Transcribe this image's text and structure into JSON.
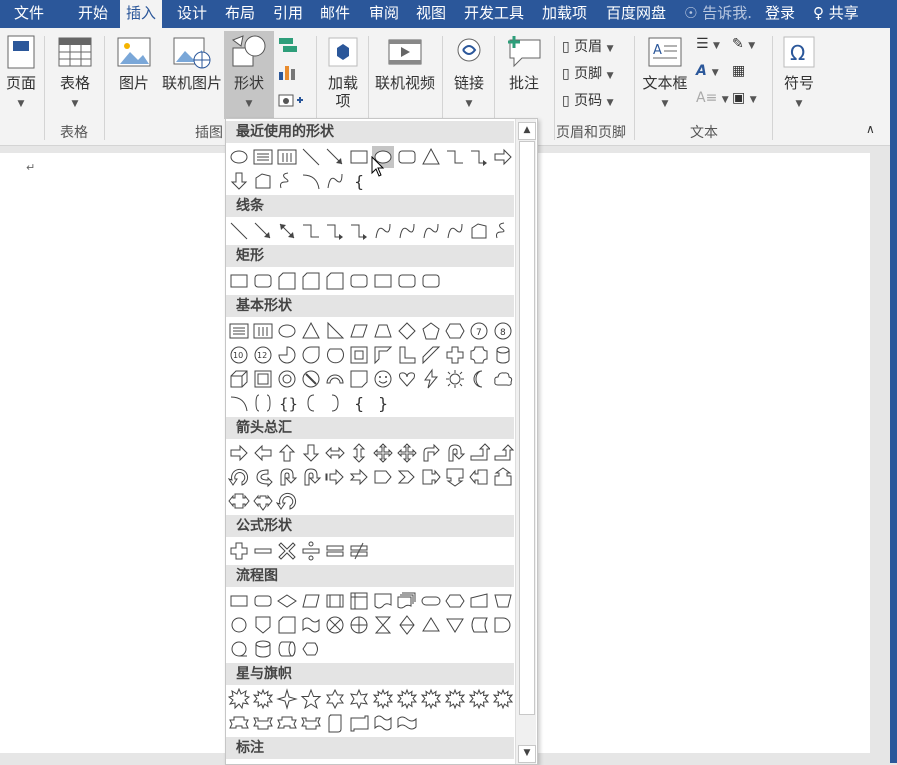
{
  "tabs": [
    "文件",
    "开始",
    "插入",
    "设计",
    "布局",
    "引用",
    "邮件",
    "审阅",
    "视图",
    "开发工具",
    "加载项",
    "百度网盘"
  ],
  "tell_me": "告诉我.",
  "login": "登录",
  "share": "共享",
  "ribbon": {
    "page": "页面",
    "table": "表格",
    "picture": "图片",
    "online_picture": "联机图片",
    "shapes": "形状",
    "addins": "加载\n项",
    "online_video": "联机视频",
    "link": "链接",
    "comment": "批注",
    "header": "页眉",
    "footer": "页脚",
    "page_number": "页码",
    "textbox": "文本框",
    "symbol": "符号",
    "groups": {
      "table": "表格",
      "illustrations": "插图",
      "header_footer": "页眉和页脚",
      "text": "文本"
    }
  },
  "shapes_panel": {
    "sections": [
      "最近使用的形状",
      "线条",
      "矩形",
      "基本形状",
      "箭头总汇",
      "公式形状",
      "流程图",
      "星与旗帜",
      "标注"
    ]
  },
  "document": {
    "paragraph_mark": "↵"
  },
  "colors": {
    "accent": "#2b579a",
    "highlight": "#c5c5c5"
  }
}
